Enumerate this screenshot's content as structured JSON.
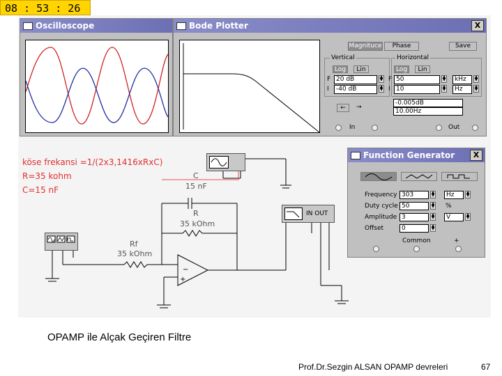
{
  "clock": "08 : 53 : 26",
  "oscilloscope": {
    "title": "Oscilloscope"
  },
  "bode": {
    "title": "Bode Plotter",
    "close": "X",
    "tabs": {
      "magnitude": "Magnituce",
      "phase": "Phase",
      "save": "Save"
    },
    "vertical": {
      "label": "Vertical",
      "log": "Log",
      "lin": "Lin",
      "f_label": "F",
      "i_label": "I",
      "f_value": "20 dB",
      "i_value": "-40 dB"
    },
    "horizontal": {
      "label": "Horizontal",
      "log": "Log",
      "lin": "Lin",
      "f_label": "F",
      "i_label": "I",
      "f_value": "50",
      "f_unit": "kHz",
      "i_value": "10",
      "i_unit": "Hz"
    },
    "readout": {
      "db": "-0.005dB",
      "hz": "10.00Hz"
    },
    "arrow_left": "←",
    "arrow_right": "→",
    "in_label": "In",
    "out_label": "Out"
  },
  "funcgen": {
    "title": "Function Generator",
    "close": "X",
    "rows": [
      {
        "label": "Frequency",
        "value": "303",
        "unit": "Hz"
      },
      {
        "label": "Duty cycle",
        "value": "50",
        "unit": "%"
      },
      {
        "label": "Amplitude",
        "value": "3",
        "unit": "V"
      },
      {
        "label": "Offset",
        "value": "0",
        "unit": ""
      }
    ],
    "common": "Common",
    "plus": "+"
  },
  "circuit": {
    "formula": "köse frekansi  =1/(2x3,1416xRxC)",
    "r_val": "R=35 kohm",
    "c_val": "C=15 nF",
    "c_label": "C",
    "c_value": "15 nF",
    "r_label": "R",
    "r_value": "35 kOhm",
    "rf_label": "Rf",
    "rf_value": "35 kOhm",
    "in_out": "IN  OUT"
  },
  "caption": "OPAMP ile Alçak Geçiren Filtre",
  "footer": {
    "author": "Prof.Dr.Sezgin ALSAN  OPAMP devreleri",
    "page": "67"
  }
}
